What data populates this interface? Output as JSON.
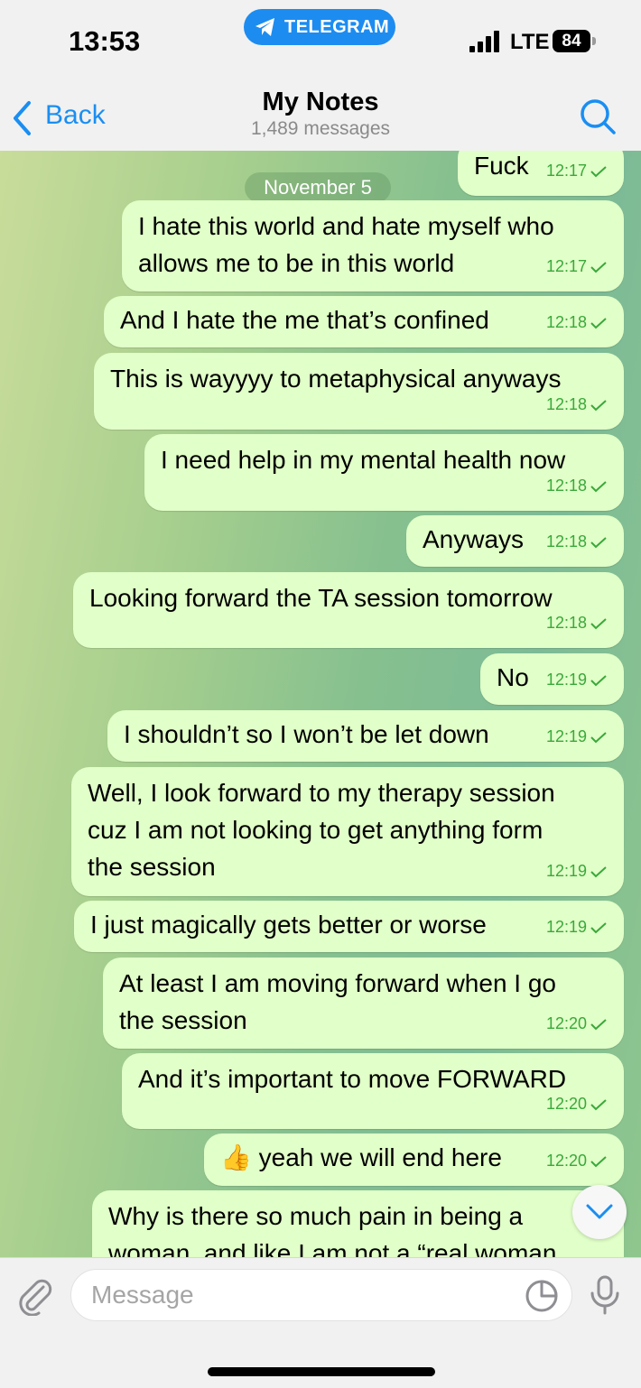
{
  "status_bar": {
    "time": "13:53",
    "app_pill": "TELEGRAM",
    "network": "LTE",
    "battery": "84"
  },
  "header": {
    "back_label": "Back",
    "title": "My Notes",
    "subtitle": "1,489 messages"
  },
  "chat": {
    "date_chip": "November 5",
    "messages": [
      {
        "text": "Fuck",
        "time": "12:17"
      },
      {
        "text": "I hate this world and hate myself who\nallows me to be in this world",
        "time": "12:17"
      },
      {
        "text": "And I hate the me that’s confined",
        "time": "12:18"
      },
      {
        "text": "This is wayyyy to metaphysical anyways",
        "time": "12:18"
      },
      {
        "text": "I need help in my mental health now",
        "time": "12:18"
      },
      {
        "text": "Anyways",
        "time": "12:18"
      },
      {
        "text": "Looking forward the TA session tomorrow",
        "time": "12:18"
      },
      {
        "text": "No",
        "time": "12:19"
      },
      {
        "text": "I shouldn’t so I won’t be let down",
        "time": "12:19"
      },
      {
        "text": "Well, I look forward to my therapy session\ncuz I am not looking to get anything form\nthe session",
        "time": "12:19"
      },
      {
        "text": "I just magically gets better or worse",
        "time": "12:19"
      },
      {
        "text": "At least I am moving forward when I go\nthe session",
        "time": "12:20"
      },
      {
        "text": "And it’s important to move FORWARD",
        "time": "12:20"
      },
      {
        "text": "👍 yeah we will end here",
        "time": "12:20"
      },
      {
        "text": "Why is there so much pain in being a\nwoman, and like I am not a “real woman",
        "time": ""
      }
    ]
  },
  "input_bar": {
    "placeholder": "Message"
  },
  "colors": {
    "accent": "#1a8ef2",
    "bubble": "#e1ffc8",
    "check": "#3aa83b"
  },
  "icons": [
    "telegram-plane-icon",
    "signal-icon",
    "back-chevron-icon",
    "search-icon",
    "checkmark-icon",
    "chevron-down-icon",
    "paperclip-icon",
    "sticker-icon",
    "microphone-icon"
  ]
}
